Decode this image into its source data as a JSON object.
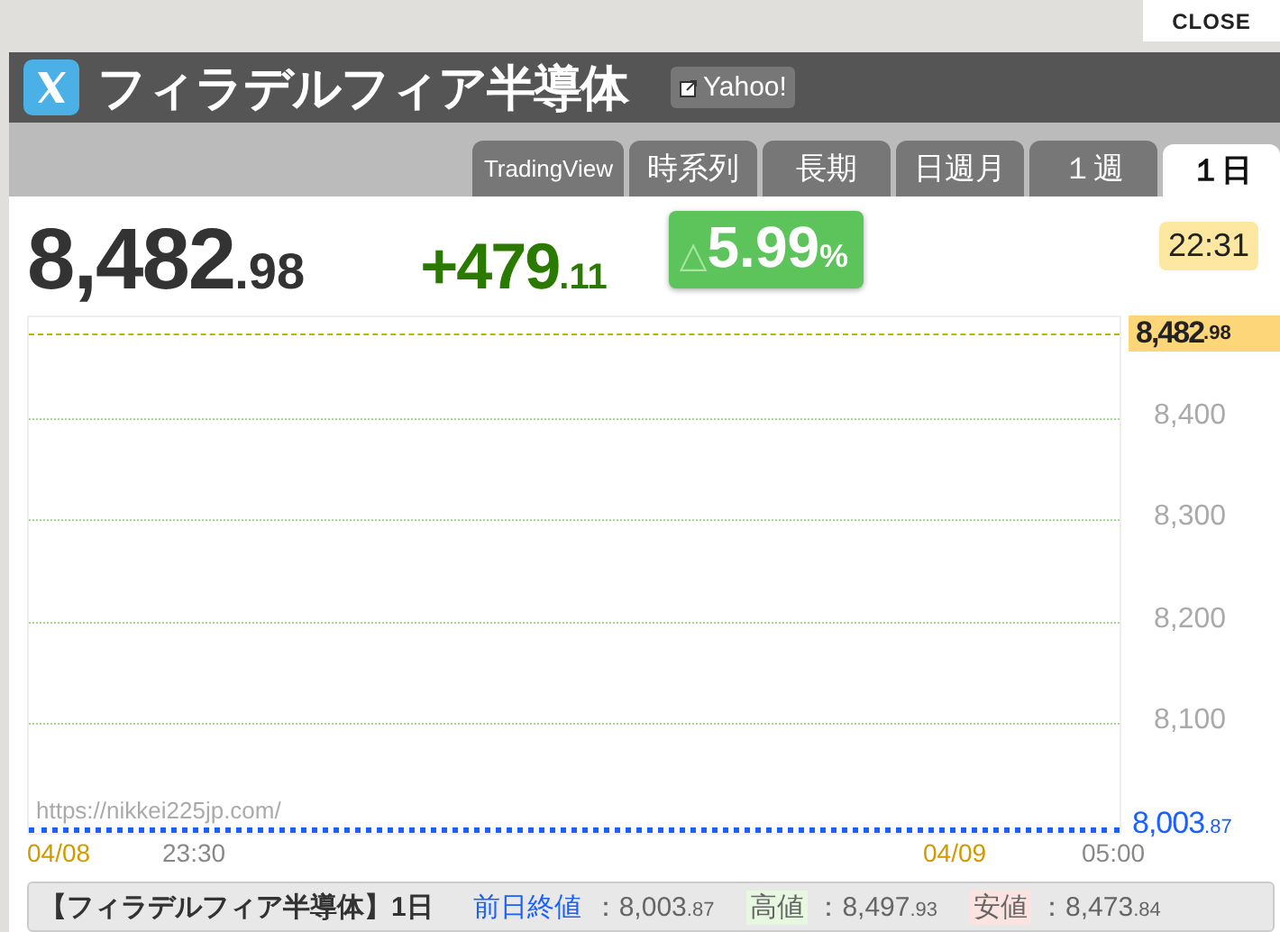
{
  "close_button": "CLOSE",
  "header": {
    "title": "フィラデルフィア半導体",
    "source_link": "Yahoo!"
  },
  "tabs": [
    {
      "label": "TradingView",
      "selected": false
    },
    {
      "label": "時系列",
      "selected": false
    },
    {
      "label": "長期",
      "selected": false
    },
    {
      "label": "日週月",
      "selected": false
    },
    {
      "label": "１週",
      "selected": false
    },
    {
      "label": "１日",
      "selected": true
    }
  ],
  "quote": {
    "price": {
      "integer": "8,482",
      "decimal": ".98"
    },
    "change": {
      "integer": "+479",
      "decimal": ".11"
    },
    "change_percent": {
      "value": "5.99",
      "unit": "%",
      "arrow": "△"
    },
    "time": "22:31"
  },
  "chart": {
    "watermark": "https://nikkei225jp.com/",
    "current_price": {
      "integer": "8,482",
      "decimal": ".98"
    },
    "previous_close": {
      "integer": "8,003",
      "decimal": ".87"
    },
    "y_labels": [
      "8,400",
      "8,300",
      "8,200",
      "8,100"
    ],
    "x_labels": [
      {
        "text": "04/08",
        "kind": "date"
      },
      {
        "text": "23:30",
        "kind": "time"
      },
      {
        "text": "04/09",
        "kind": "date"
      },
      {
        "text": "05:00",
        "kind": "time"
      }
    ]
  },
  "summary": {
    "title": "【フィラデルフィア半導体】1日",
    "items": [
      {
        "label": "前日終値",
        "kind": "close",
        "separator": "：",
        "integer": "8,003",
        "decimal": ".87"
      },
      {
        "label": "高値",
        "kind": "high",
        "separator": "：",
        "integer": "8,497",
        "decimal": ".93"
      },
      {
        "label": "安値",
        "kind": "low",
        "separator": "：",
        "integer": "8,473",
        "decimal": ".84"
      }
    ]
  }
}
